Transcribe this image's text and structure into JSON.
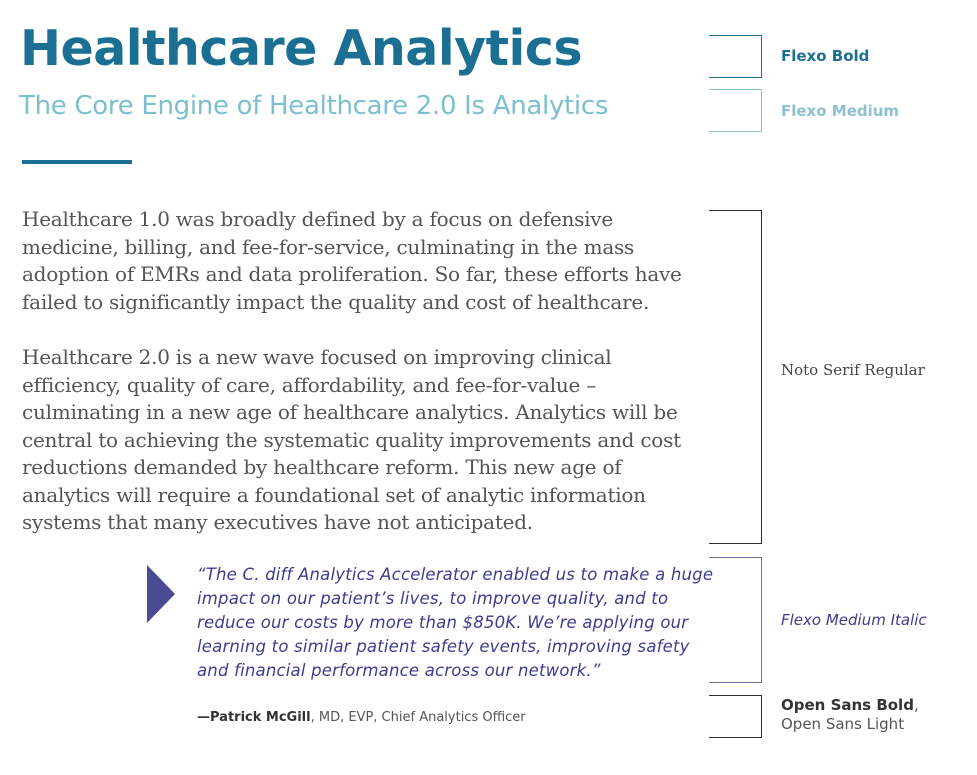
{
  "header": {
    "title": "Healthcare Analytics",
    "subtitle": "The Core Engine of Healthcare 2.0 Is Analytics"
  },
  "body": {
    "paragraph1": [
      "Healthcare 1.0 was broadly defined by a focus on defensive",
      "medicine, billing, and fee-for-service, culminating in the mass",
      "adoption of EMRs and data proliferation. So far, these efforts have",
      "failed to significantly impact the quality and cost of healthcare."
    ],
    "paragraph2": [
      "Healthcare 2.0 is a new wave focused on improving clinical",
      "efficiency, quality of care, affordability, and fee-for-value –",
      "culminating in a new age of healthcare analytics. Analytics will be",
      "central to achieving the systematic quality improvements and cost",
      "reductions demanded by healthcare reform. This new age of",
      "analytics will require a foundational set of analytic information",
      "systems that many executives have not anticipated."
    ]
  },
  "quote": {
    "lines": [
      "“The C. diff Analytics Accelerator enabled us to make a huge",
      "impact on our patient’s lives, to improve quality, and to",
      "reduce our costs by more than $850K. We’re applying our",
      "learning to similar patient safety events, improving safety",
      "and financial performance across our network.”"
    ],
    "attribution_name": "—Patrick McGill",
    "attribution_title": ", MD, EVP, Chief Analytics Officer"
  },
  "font_labels": {
    "title_font": "Flexo Bold",
    "subtitle_font": "Flexo Medium",
    "body_font": "Noto Serif Regular",
    "quote_font": "Flexo Medium Italic",
    "attribution_font_bold": "Open Sans Bold",
    "attribution_font_separator": ",",
    "attribution_font_light": "Open Sans Light"
  },
  "colors": {
    "primary_blue": "#1b6f93",
    "light_teal": "#7cc0cf",
    "quote_purple": "#3d3d8f",
    "body_gray": "#545454"
  }
}
